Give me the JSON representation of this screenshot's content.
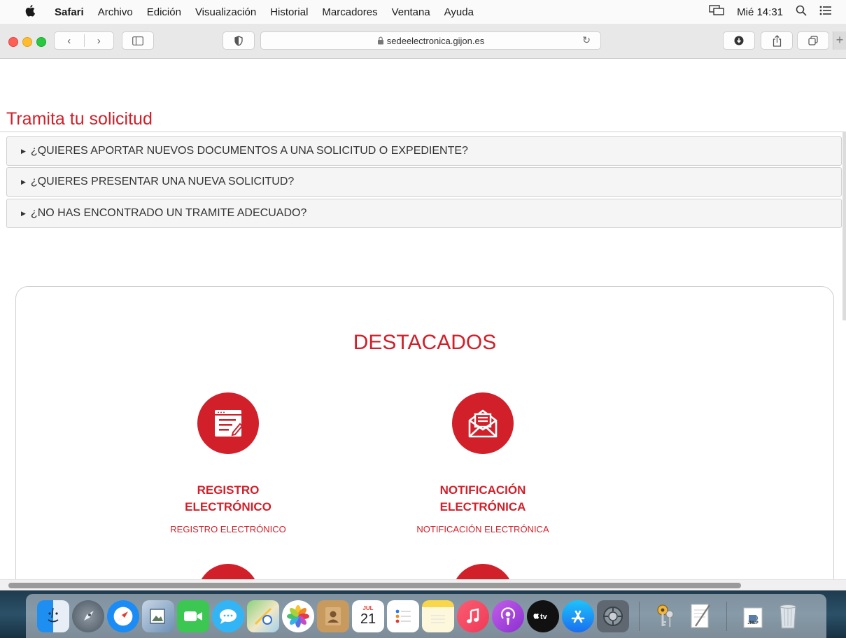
{
  "menubar": {
    "apple_icon": "apple-icon",
    "app_name": "Safari",
    "menus": [
      "Archivo",
      "Edición",
      "Visualización",
      "Historial",
      "Marcadores",
      "Ventana",
      "Ayuda"
    ],
    "clock": "Mié 14:31",
    "right_icons": [
      "airplay-display-icon",
      "spotlight-search-icon",
      "control-center-icon"
    ]
  },
  "toolbar": {
    "url": "sedeelectronica.gijon.es",
    "back_icon": "‹",
    "forward_icon": "›",
    "new_tab_icon": "+"
  },
  "page": {
    "title": "Tramita tu solicitud",
    "accordion": [
      "¿QUIERES APORTAR NUEVOS DOCUMENTOS A UNA SOLICITUD O EXPEDIENTE?",
      "¿QUIERES PRESENTAR UNA NUEVA SOLICITUD?",
      "¿NO HAS ENCONTRADO UN TRAMITE ADECUADO?"
    ],
    "destacados": {
      "title": "DESTACADOS",
      "cards": [
        {
          "title_line1": "REGISTRO",
          "title_line2": "ELECTRÓNICO",
          "subtitle": "REGISTRO ELECTRÓNICO",
          "icon": "form-edit-icon"
        },
        {
          "title_line1": "NOTIFICACIÓN",
          "title_line2": "ELECTRÓNICA",
          "subtitle": "NOTIFICACIÓN ELECTRÓNICA",
          "icon": "envelope-letter-icon"
        }
      ]
    }
  },
  "dock": {
    "calendar_day": "21",
    "calendar_month": "JUL",
    "items": [
      "finder-icon",
      "launchpad-icon",
      "safari-icon",
      "preview-icon",
      "facetime-icon",
      "messages-icon",
      "maps-icon",
      "photos-icon",
      "contacts-icon",
      "calendar-icon",
      "reminders-icon",
      "notes-icon",
      "music-icon",
      "podcasts-icon",
      "apple-tv-icon",
      "app-store-icon",
      "system-preferences-icon",
      "keychain-icon",
      "textedit-icon",
      "jnlp-file-icon",
      "trash-icon"
    ],
    "jnlp_label": "JNLP"
  },
  "colors": {
    "accent": "#d1202a"
  }
}
